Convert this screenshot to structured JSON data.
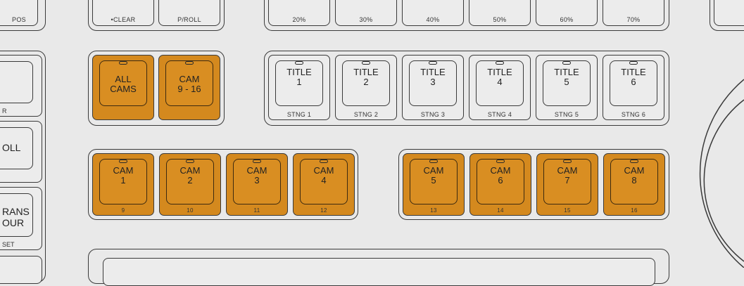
{
  "top_row": {
    "left_labels": [
      "POS"
    ],
    "mid_labels": [
      "•CLEAR",
      "P/ROLL"
    ],
    "right_labels": [
      "20%",
      "30%",
      "40%",
      "50%",
      "60%",
      "70%"
    ]
  },
  "left_column": {
    "keys": [
      {
        "text": "",
        "sub": "R"
      },
      {
        "text": "OLL",
        "sub": ""
      },
      {
        "text": "RANS\nOUR",
        "sub": "SET"
      }
    ]
  },
  "all_cams_group": {
    "keys": [
      {
        "text": "ALL\nCAMS",
        "sub": ""
      },
      {
        "text": "CAM\n9 - 16",
        "sub": ""
      }
    ]
  },
  "title_group": {
    "keys": [
      {
        "text": "TITLE\n1",
        "sub": "STNG 1"
      },
      {
        "text": "TITLE\n2",
        "sub": "STNG 2"
      },
      {
        "text": "TITLE\n3",
        "sub": "STNG 3"
      },
      {
        "text": "TITLE\n4",
        "sub": "STNG 4"
      },
      {
        "text": "TITLE\n5",
        "sub": "STNG 5"
      },
      {
        "text": "TITLE\n6",
        "sub": "STNG 6"
      }
    ]
  },
  "cam_group_a": {
    "keys": [
      {
        "text": "CAM\n1",
        "sub": "9"
      },
      {
        "text": "CAM\n2",
        "sub": "10"
      },
      {
        "text": "CAM\n3",
        "sub": "11"
      },
      {
        "text": "CAM\n4",
        "sub": "12"
      }
    ]
  },
  "cam_group_b": {
    "keys": [
      {
        "text": "CAM\n5",
        "sub": "13"
      },
      {
        "text": "CAM\n6",
        "sub": "14"
      },
      {
        "text": "CAM\n7",
        "sub": "15"
      },
      {
        "text": "CAM\n8",
        "sub": "16"
      }
    ]
  },
  "colors": {
    "amber": "#d4891e",
    "panel": "#e9e9e9",
    "outline": "#3a3a3a"
  }
}
